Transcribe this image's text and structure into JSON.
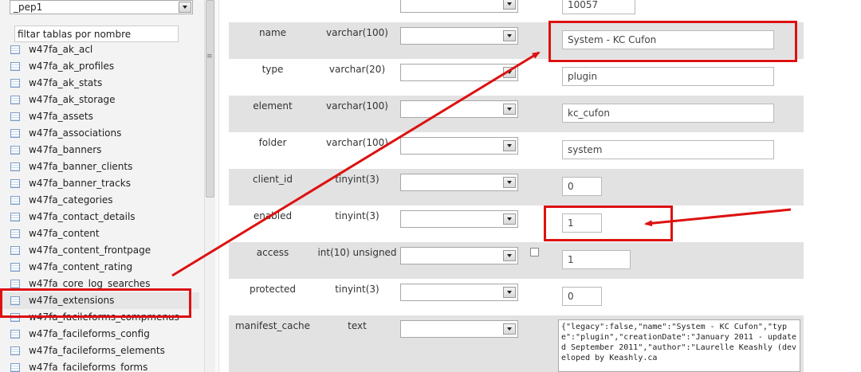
{
  "sidebar": {
    "database_select": "_pep1",
    "filter_value": "filtar tablas por nombre",
    "tables": [
      "w47fa_ak_acl",
      "w47fa_ak_profiles",
      "w47fa_ak_stats",
      "w47fa_ak_storage",
      "w47fa_assets",
      "w47fa_associations",
      "w47fa_banners",
      "w47fa_banner_clients",
      "w47fa_banner_tracks",
      "w47fa_categories",
      "w47fa_contact_details",
      "w47fa_content",
      "w47fa_content_frontpage",
      "w47fa_content_rating",
      "w47fa_core_log_searches",
      "w47fa_extensions",
      "w47fa_facileforms_compmenus",
      "w47fa_facileforms_config",
      "w47fa_facileforms_elements",
      "w47fa_facileforms_forms"
    ],
    "selected_table": "w47fa_extensions"
  },
  "form": {
    "top_value": "10057",
    "rows": [
      {
        "name": "name",
        "type": "varchar(100)",
        "value": "System - KC Cufon"
      },
      {
        "name": "type",
        "type": "varchar(20)",
        "value": "plugin"
      },
      {
        "name": "element",
        "type": "varchar(100)",
        "value": "kc_cufon"
      },
      {
        "name": "folder",
        "type": "varchar(100)",
        "value": "system"
      },
      {
        "name": "client_id",
        "type": "tinyint(3)",
        "value": "0"
      },
      {
        "name": "enabled",
        "type": "tinyint(3)",
        "value": "1"
      },
      {
        "name": "access",
        "type": "int(10) unsigned",
        "value": "1"
      },
      {
        "name": "protected",
        "type": "tinyint(3)",
        "value": "0"
      },
      {
        "name": "manifest_cache",
        "type": "text",
        "value": "{\"legacy\":false,\"name\":\"System - KC Cufon\",\"type\":\"plugin\",\"creationDate\":\"January 2011 - updated September 2011\",\"author\":\"Laurelle Keashly (developed by Keashly.ca"
      }
    ]
  },
  "colors": {
    "annotation": "#dd1111",
    "row_stripe": "#e2e2e2",
    "sidebar_bg": "#f3f3f3"
  }
}
